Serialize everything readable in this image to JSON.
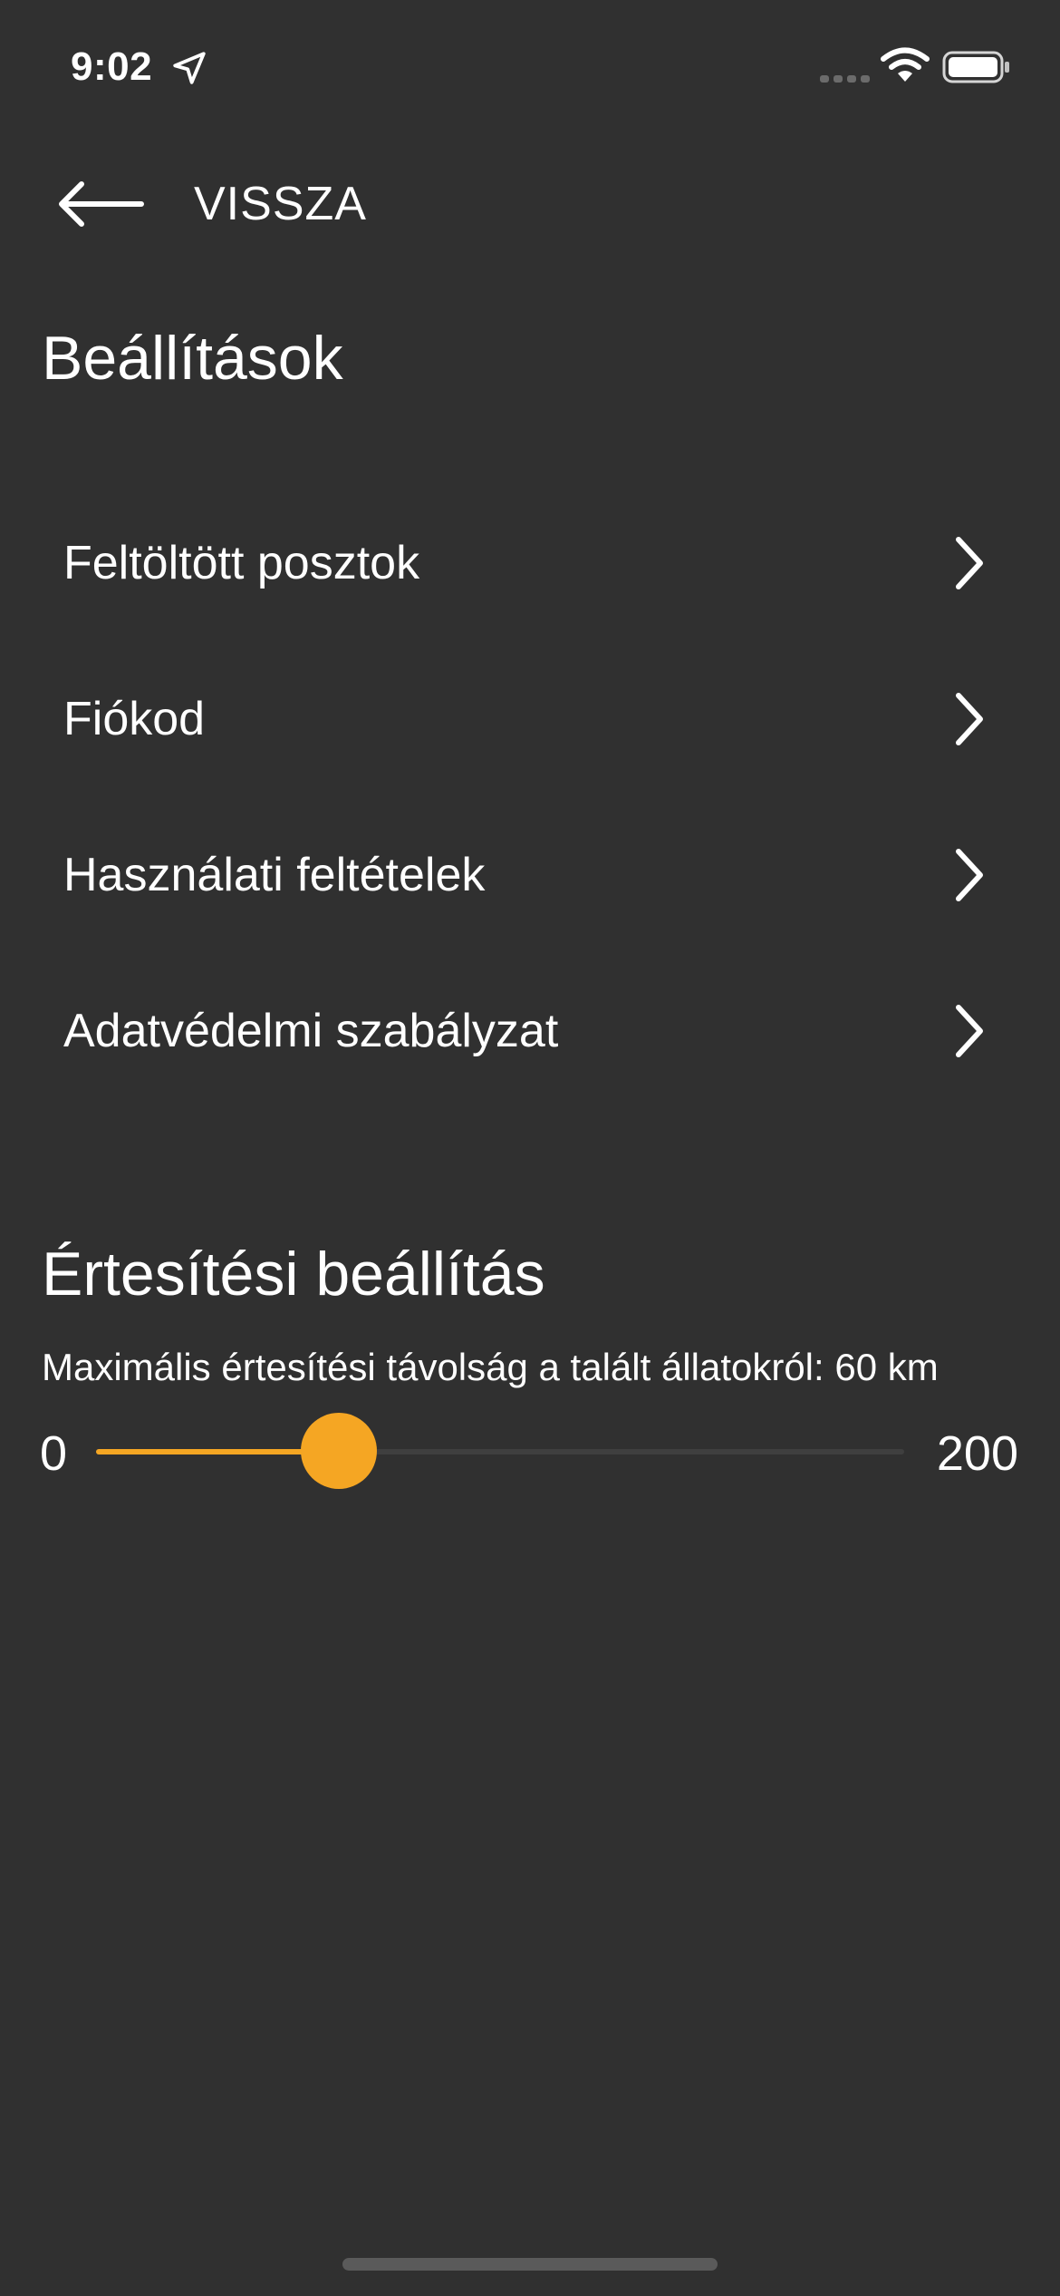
{
  "status_bar": {
    "time": "9:02",
    "icons": [
      "location-arrow-icon",
      "cellular-signal-icon",
      "wifi-icon",
      "battery-icon"
    ]
  },
  "nav": {
    "back_label": "VISSZA",
    "back_icon": "arrow-left-icon"
  },
  "page": {
    "title": "Beállítások"
  },
  "menu": {
    "items": [
      {
        "label": "Feltöltött posztok",
        "icon": "chevron-right-icon"
      },
      {
        "label": "Fiókod",
        "icon": "chevron-right-icon"
      },
      {
        "label": "Használati feltételek",
        "icon": "chevron-right-icon"
      },
      {
        "label": "Adatvédelmi szabályzat",
        "icon": "chevron-right-icon"
      }
    ]
  },
  "notification": {
    "section_title": "Értesítési beállítás",
    "description": "Maximális értesítési távolság a talált állatokról: 60 km",
    "slider": {
      "min_label": "0",
      "max_label": "200",
      "min": 0,
      "max": 200,
      "value": 60
    }
  },
  "colors": {
    "background": "#303030",
    "accent": "#f5a623",
    "text": "#ffffff",
    "track": "#3f3f3f"
  }
}
